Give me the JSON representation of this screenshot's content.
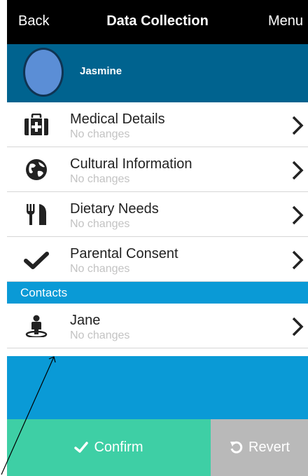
{
  "nav": {
    "back": "Back",
    "title": "Data Collection",
    "menu": "Menu"
  },
  "profile": {
    "name": "Jasmine"
  },
  "items": [
    {
      "title": "Medical Details",
      "status": "No changes",
      "icon": "medical-kit-icon"
    },
    {
      "title": "Cultural Information",
      "status": "No changes",
      "icon": "globe-icon"
    },
    {
      "title": "Dietary Needs",
      "status": "No changes",
      "icon": "fork-knife-icon"
    },
    {
      "title": "Parental Consent",
      "status": "No changes",
      "icon": "checkmark-icon"
    }
  ],
  "contacts": {
    "header": "Contacts",
    "items": [
      {
        "title": "Jane",
        "status": "No changes",
        "icon": "person-icon"
      }
    ]
  },
  "actions": {
    "confirm": "Confirm",
    "revert": "Revert"
  },
  "colors": {
    "navbar": "#000000",
    "profile_bar": "#00638f",
    "section": "#0a9ad6",
    "confirm": "#3ecfa5",
    "revert": "#b9b9b9"
  }
}
